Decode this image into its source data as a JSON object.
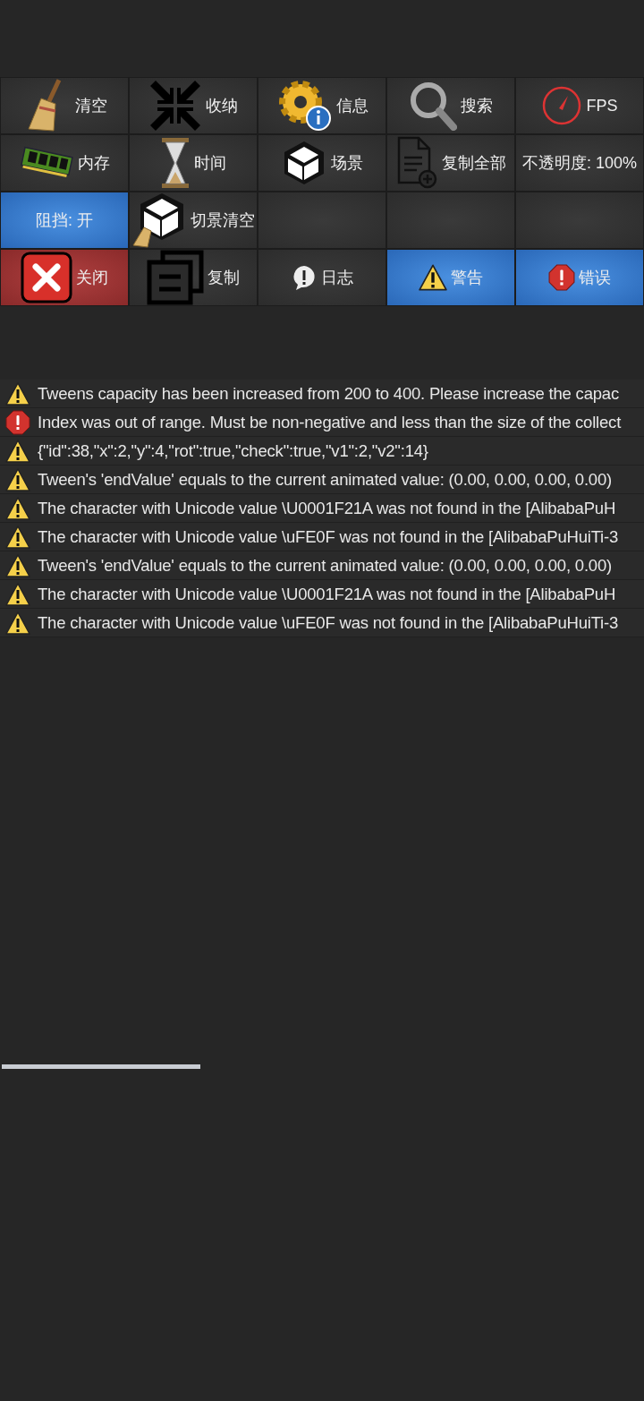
{
  "toolbar": [
    {
      "kind": "action",
      "label": "清空",
      "selected": false
    },
    {
      "kind": "action",
      "label": "收纳",
      "selected": false
    },
    {
      "kind": "action",
      "label": "信息",
      "selected": false
    },
    {
      "kind": "action",
      "label": "搜索",
      "selected": false
    },
    {
      "kind": "action",
      "label": "FPS",
      "selected": false
    },
    {
      "kind": "action",
      "label": "内存",
      "selected": false
    },
    {
      "kind": "action",
      "label": "时间",
      "selected": false
    },
    {
      "kind": "action",
      "label": "场景",
      "selected": false
    },
    {
      "kind": "action",
      "label": "复制全部",
      "selected": false
    },
    {
      "kind": "action",
      "label": "不透明度: 100%",
      "selected": false
    },
    {
      "kind": "action",
      "label": "阻挡: 开",
      "selected": true
    },
    {
      "kind": "action",
      "label": "切景清空",
      "selected": false
    },
    {
      "kind": "empty"
    },
    {
      "kind": "empty"
    },
    {
      "kind": "empty"
    },
    {
      "kind": "danger",
      "label": "关闭"
    },
    {
      "kind": "action",
      "label": "复制",
      "selected": false
    },
    {
      "kind": "action",
      "label": "日志",
      "selected": false
    },
    {
      "kind": "action",
      "label": "警告",
      "selected": true
    },
    {
      "kind": "action",
      "label": "错误",
      "selected": true
    }
  ],
  "log": [
    {
      "kind": "warning",
      "text": "Tweens capacity has been increased from 200 to 400. Please increase the capac"
    },
    {
      "kind": "error",
      "text": "Index was out of range. Must be non-negative and less than the size of the collect"
    },
    {
      "kind": "warning",
      "text": "{\"id\":38,\"x\":2,\"y\":4,\"rot\":true,\"check\":true,\"v1\":2,\"v2\":14}"
    },
    {
      "kind": "warning",
      "text": "Tween's 'endValue' equals to the current animated value: (0.00, 0.00, 0.00, 0.00)"
    },
    {
      "kind": "warning",
      "text": "The character with Unicode value \\U0001F21A was not found in the [AlibabaPuH"
    },
    {
      "kind": "warning",
      "text": "The character with Unicode value \\uFE0F was not found in the [AlibabaPuHuiTi-3"
    },
    {
      "kind": "warning",
      "text": "Tween's 'endValue' equals to the current animated value: (0.00, 0.00, 0.00, 0.00)"
    },
    {
      "kind": "warning",
      "text": "The character with Unicode value \\U0001F21A was not found in the [AlibabaPuH"
    },
    {
      "kind": "warning",
      "text": "The character with Unicode value \\uFE0F was not found in the [AlibabaPuHuiTi-3"
    }
  ]
}
